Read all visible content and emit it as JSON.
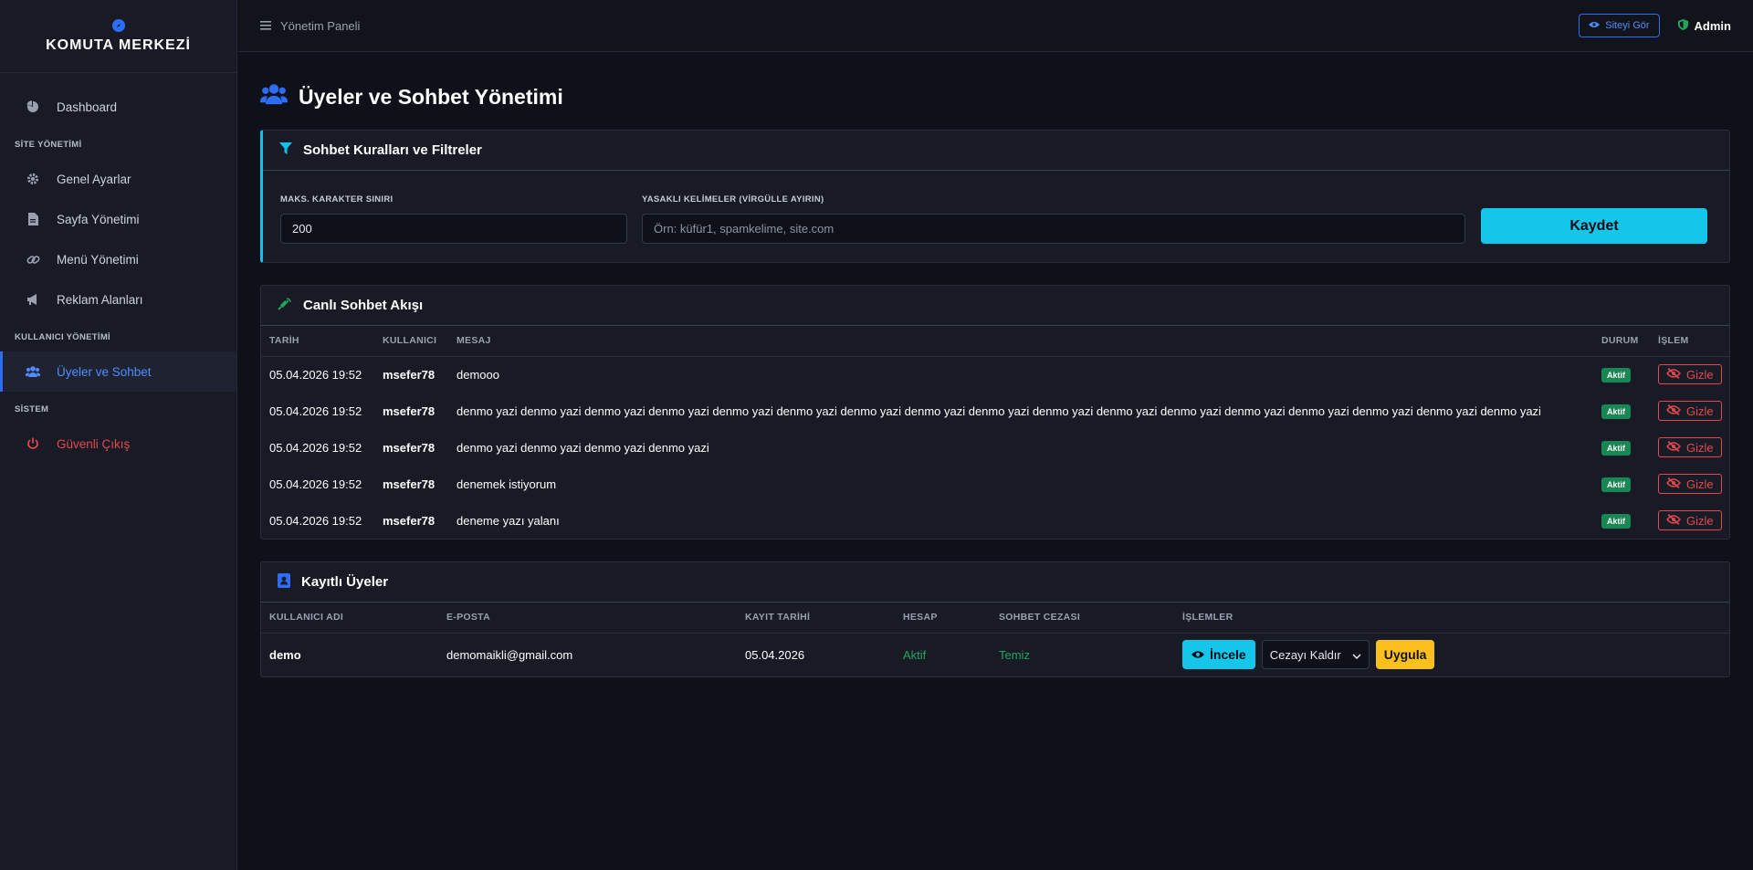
{
  "sidebar": {
    "brand": "KOMUTA MERKEZİ",
    "dashboard": "Dashboard",
    "section_site": "SİTE YÖNETİMİ",
    "general": "Genel Ayarlar",
    "pages": "Sayfa Yönetimi",
    "menu": "Menü Yönetimi",
    "ads": "Reklam Alanları",
    "section_users": "KULLANICI YÖNETİMİ",
    "members": "Üyeler ve Sohbet",
    "section_system": "SİSTEM",
    "logout": "Güvenli Çıkış"
  },
  "topbar": {
    "breadcrumb": "Yönetim Paneli",
    "site_button": "Siteyi Gör",
    "user": "Admin"
  },
  "page": {
    "title": "Üyeler ve Sohbet Yönetimi"
  },
  "rules": {
    "title": "Sohbet Kuralları ve Filtreler",
    "max_label": "MAKS. KARAKTER SINIRI",
    "max_value": "200",
    "banned_label": "YASAKLI KELİMELER (VİRGÜLLE AYIRIN)",
    "banned_placeholder": "Örn: küfür1, spamkelime, site.com",
    "save": "Kaydet"
  },
  "chat": {
    "title": "Canlı Sohbet Akışı",
    "columns": [
      "TARİH",
      "KULLANICI",
      "MESAJ",
      "DURUM",
      "İŞLEM"
    ],
    "status_label": "Aktif",
    "hide_label": "Gizle",
    "rows": [
      {
        "date": "05.04.2026 19:52",
        "user": "msefer78",
        "message": "demooo"
      },
      {
        "date": "05.04.2026 19:52",
        "user": "msefer78",
        "message": "denmo yazi denmo yazi denmo yazi denmo yazi denmo yazi denmo yazi denmo yazi denmo yazi denmo yazi denmo yazi denmo yazi denmo yazi denmo yazi denmo yazi denmo yazi denmo yazi denmo yazi"
      },
      {
        "date": "05.04.2026 19:52",
        "user": "msefer78",
        "message": "denmo yazi denmo yazi denmo yazi denmo yazi"
      },
      {
        "date": "05.04.2026 19:52",
        "user": "msefer78",
        "message": "denemek istiyorum"
      },
      {
        "date": "05.04.2026 19:52",
        "user": "msefer78",
        "message": "deneme yazı yalanı"
      }
    ]
  },
  "members": {
    "title": "Kayıtlı Üyeler",
    "columns": [
      "KULLANICI ADI",
      "E-POSTA",
      "KAYIT TARİHİ",
      "HESAP",
      "SOHBET CEZASI",
      "İŞLEMLER"
    ],
    "rows": [
      {
        "username": "demo",
        "email": "demomaikli@gmail.com",
        "date": "05.04.2026",
        "account": "Aktif",
        "penalty": "Temiz"
      }
    ],
    "view_label": "İncele",
    "select_value": "Cezayı Kaldır",
    "apply_label": "Uygula"
  },
  "colors": {
    "accent": "#2d6df6",
    "cyan": "#15c5ea",
    "success": "#198754",
    "danger": "#e5484d",
    "warning": "#fcc01c"
  }
}
